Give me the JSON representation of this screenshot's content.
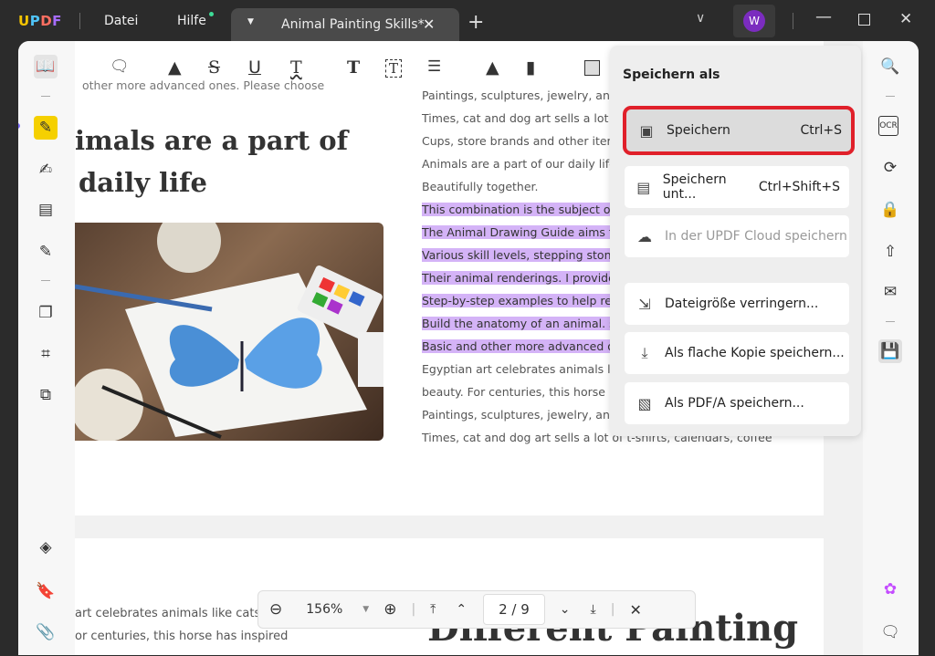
{
  "titlebar": {
    "logo": "UPDF",
    "menu": [
      "Datei",
      "Hilfe"
    ],
    "tab_title": "Animal Painting Skills*",
    "avatar": "W"
  },
  "colors": {
    "accent": "#7b2cbf",
    "highlight": "#d4b3f7",
    "red_outline": "#e0202a"
  },
  "document": {
    "top_cut": "other more advanced ones. Please choose",
    "heading": [
      "imals are a part of",
      "daily life"
    ],
    "right_lines": [
      {
        "t": "Paintings, sculptures, jewelry, and",
        "h": false
      },
      {
        "t": "Times, cat and dog art sells a lot of",
        "h": false
      },
      {
        "t": "Cups, store brands and other items",
        "h": false
      },
      {
        "t": "Animals are a part of our daily life,",
        "h": false
      },
      {
        "t": "Beautifully together.",
        "h": false
      },
      {
        "t": "This combination is the subject of",
        "h": true
      },
      {
        "t": "The Animal Drawing Guide aims to",
        "h": true
      },
      {
        "t": "Various skill levels, stepping stone",
        "h": true
      },
      {
        "t": "Their animal renderings. I provide",
        "h": true
      },
      {
        "t": "Step-by-step examples to help read",
        "h": true
      },
      {
        "t": "Build the anatomy of an animal. so",
        "h": true
      },
      {
        "t": "Basic and other more advanced on",
        "h": true
      },
      {
        "t": "Egyptian art celebrates animals lik",
        "h": false
      },
      {
        "t": "beauty. For centuries, this horse ha",
        "h": false
      },
      {
        "t": "Paintings, sculptures, jewelry, and",
        "h": false
      },
      {
        "t": "Times, cat and dog art sells a lot of t-shirts, calendars, coffee",
        "h": false
      }
    ],
    "page2_lines": [
      "art celebrates animals like cats w",
      "or centuries, this horse has inspired"
    ],
    "page2_heading": "Different Painting"
  },
  "save_menu": {
    "title": "Speichern als",
    "items": [
      {
        "label": "Speichern",
        "shortcut": "Ctrl+S",
        "icon": "save-icon"
      },
      {
        "label": "Speichern unt...",
        "shortcut": "Ctrl+Shift+S",
        "icon": "save-as-icon"
      },
      {
        "label": "In der UPDF Cloud speichern",
        "shortcut": "",
        "icon": "cloud-upload-icon",
        "disabled": true
      },
      {
        "label": "Dateigröße verringern...",
        "shortcut": "",
        "icon": "compress-icon"
      },
      {
        "label": "Als flache Kopie speichern...",
        "shortcut": "",
        "icon": "flatten-icon"
      },
      {
        "label": "Als PDF/A speichern...",
        "shortcut": "",
        "icon": "pdfa-icon"
      }
    ]
  },
  "zoombar": {
    "zoom": "156%",
    "page": "2 / 9"
  }
}
